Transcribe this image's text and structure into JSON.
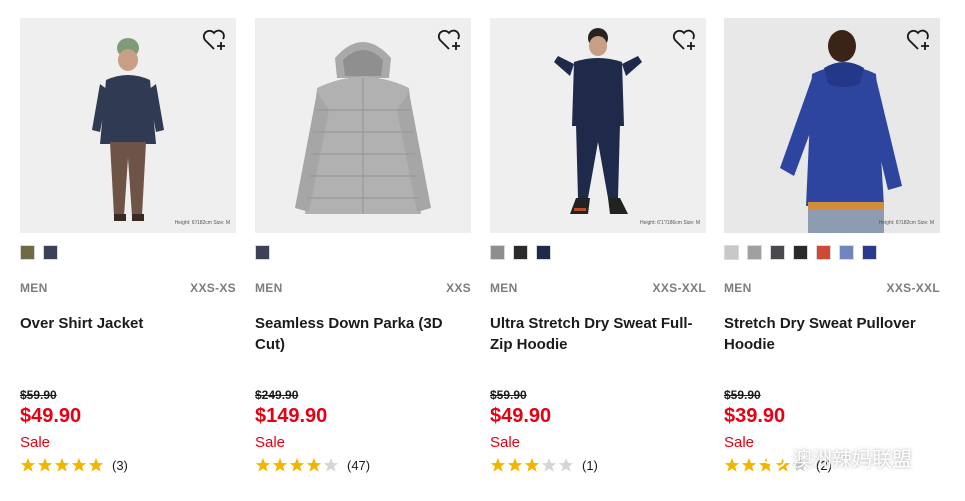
{
  "accent_color": "#e60012",
  "products": [
    {
      "photo_note": "Height: 6'/182cm Size: M",
      "swatches": [
        "#6e6a48",
        "#3b4257"
      ],
      "gender": "MEN",
      "sizes": "XXS-XS",
      "name": "Over Shirt Jacket",
      "original_price": "$59.90",
      "price": "$49.90",
      "sale_label": "Sale",
      "rating": 5,
      "review_count": "(3)"
    },
    {
      "photo_note": "",
      "swatches": [
        "#3b4257"
      ],
      "gender": "MEN",
      "sizes": "XXS",
      "name": "Seamless Down Parka (3D Cut)",
      "original_price": "$249.90",
      "price": "$149.90",
      "sale_label": "Sale",
      "rating": 4,
      "review_count": "(47)"
    },
    {
      "photo_note": "Height: 6'1\"/186cm Size: M",
      "swatches": [
        "#8e8e8e",
        "#2b2b2e",
        "#1f2a4b"
      ],
      "gender": "MEN",
      "sizes": "XXS-XXL",
      "name": "Ultra Stretch Dry Sweat Full-Zip Hoodie",
      "original_price": "$59.90",
      "price": "$49.90",
      "sale_label": "Sale",
      "rating": 3,
      "review_count": "(1)"
    },
    {
      "photo_note": "Height: 6'/182cm Size: M",
      "swatches": [
        "#c8c8c8",
        "#a0a0a0",
        "#4a4a4e",
        "#2a2a2c",
        "#d04a35",
        "#7286bb",
        "#2a3a8c"
      ],
      "gender": "MEN",
      "sizes": "XXS-XXL",
      "name": "Stretch Dry Sweat Pullover Hoodie",
      "original_price": "$59.90",
      "price": "$39.90",
      "sale_label": "Sale",
      "rating": 4,
      "review_count": "(2)"
    }
  ],
  "icons": {
    "favorite": "heart-plus-icon",
    "star": "star-icon",
    "watermark": "wechat-icon"
  },
  "watermark": {
    "text": "澳洲辣妈联盟"
  }
}
